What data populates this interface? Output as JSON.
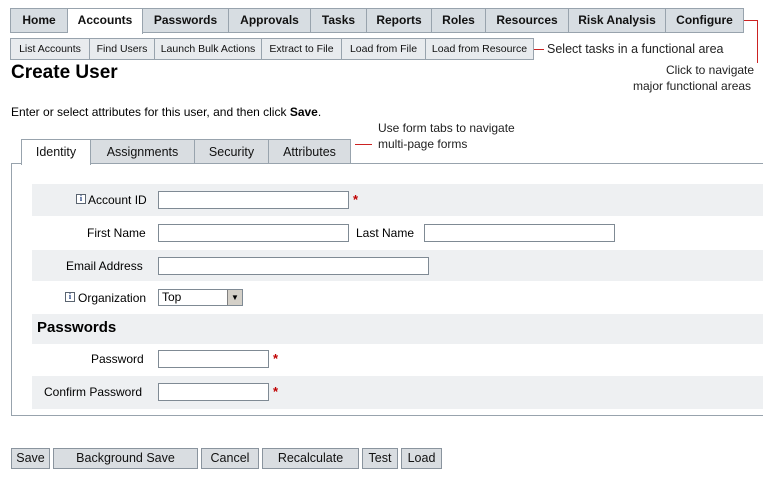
{
  "top_nav": {
    "tabs": [
      "Home",
      "Accounts",
      "Passwords",
      "Approvals",
      "Tasks",
      "Reports",
      "Roles",
      "Resources",
      "Risk Analysis",
      "Configure"
    ],
    "active": "Accounts"
  },
  "sub_nav": {
    "items": [
      "List Accounts",
      "Find Users",
      "Launch Bulk Actions",
      "Extract to File",
      "Load from File",
      "Load from Resource"
    ]
  },
  "callouts": {
    "sub_tasks": "Select tasks in a functional area",
    "nav_line1": "Click to navigate",
    "nav_line2": "major functional areas",
    "form_tabs_line1": "Use form tabs to navigate",
    "form_tabs_line2": "multi-page forms"
  },
  "page": {
    "title": "Create User",
    "intro_prefix": "Enter or select attributes for this user, and then click ",
    "intro_bold": "Save",
    "intro_suffix": "."
  },
  "form_tabs": [
    "Identity",
    "Assignments",
    "Security",
    "Attributes"
  ],
  "form": {
    "account_id_label": "Account ID",
    "first_name_label": "First Name",
    "last_name_label": "Last Name",
    "email_label": "Email Address",
    "organization_label": "Organization",
    "organization_value": "Top",
    "passwords_heading": "Passwords",
    "password_label": "Password",
    "confirm_password_label": "Confirm Password",
    "required_marker": "*",
    "info_glyph": "i"
  },
  "buttons": [
    "Save",
    "Background Save",
    "Cancel",
    "Recalculate",
    "Test",
    "Load"
  ],
  "colors": {
    "required": "#c00000",
    "callout_line": "#cc2222",
    "tab_bg": "#d7dde2"
  }
}
